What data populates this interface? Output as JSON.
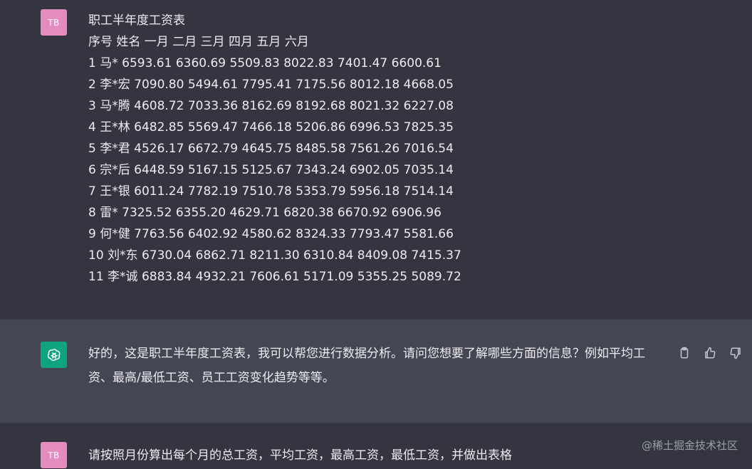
{
  "user_avatar_initials": "TB",
  "first_message": {
    "lines": [
      "职工半年度工资表",
      "序号 姓名 一月 二月 三月 四月 五月 六月",
      "1 马* 6593.61 6360.69 5509.83 8022.83 7401.47 6600.61",
      "2 李*宏 7090.80 5494.61 7795.41 7175.56 8012.18 4668.05",
      "3 马*腾 4608.72 7033.36 8162.69 8192.68 8021.32 6227.08",
      "4 王*林 6482.85 5569.47 7466.18 5206.86 6996.53 7825.35",
      "5 李*君 4526.17 6672.79 4645.75 8485.58 7561.26 7016.54",
      "6 宗*后 6448.59 5167.15 5125.67 7343.24 6902.05 7035.14",
      "7 王*银 6011.24 7782.19 7510.78 5353.79 5956.18 7514.14",
      "8 雷* 7325.52 6355.20 4629.71 6820.38 6670.92 6906.96",
      "9 何*健 7763.56 6402.92 4580.62 8324.33 7793.47 5581.66",
      "10 刘*东 6730.04 6862.71 8211.30 6310.84 8409.08 7415.37",
      "11 李*诚 6883.84 4932.21 7606.61 5171.09 5355.25 5089.72"
    ]
  },
  "assistant_message": {
    "text": "好的，这是职工半年度工资表，我可以帮您进行数据分析。请问您想要了解哪些方面的信息？例如平均工资、最高/最低工资、员工工资变化趋势等等。"
  },
  "second_message": {
    "text": "请按照月份算出每个月的总工资，平均工资，最高工资，最低工资，并做出表格"
  },
  "watermark": "@稀土掘金技术社区",
  "icons": {
    "copy": "clipboard-icon",
    "thumbs_up": "thumbs-up-icon",
    "thumbs_down": "thumbs-down-icon",
    "assistant_logo": "openai-logo-icon"
  },
  "colors": {
    "user_bg": "#343541",
    "assistant_bg": "#444654",
    "user_avatar": "#e58bbd",
    "assistant_avatar": "#10a37f"
  }
}
